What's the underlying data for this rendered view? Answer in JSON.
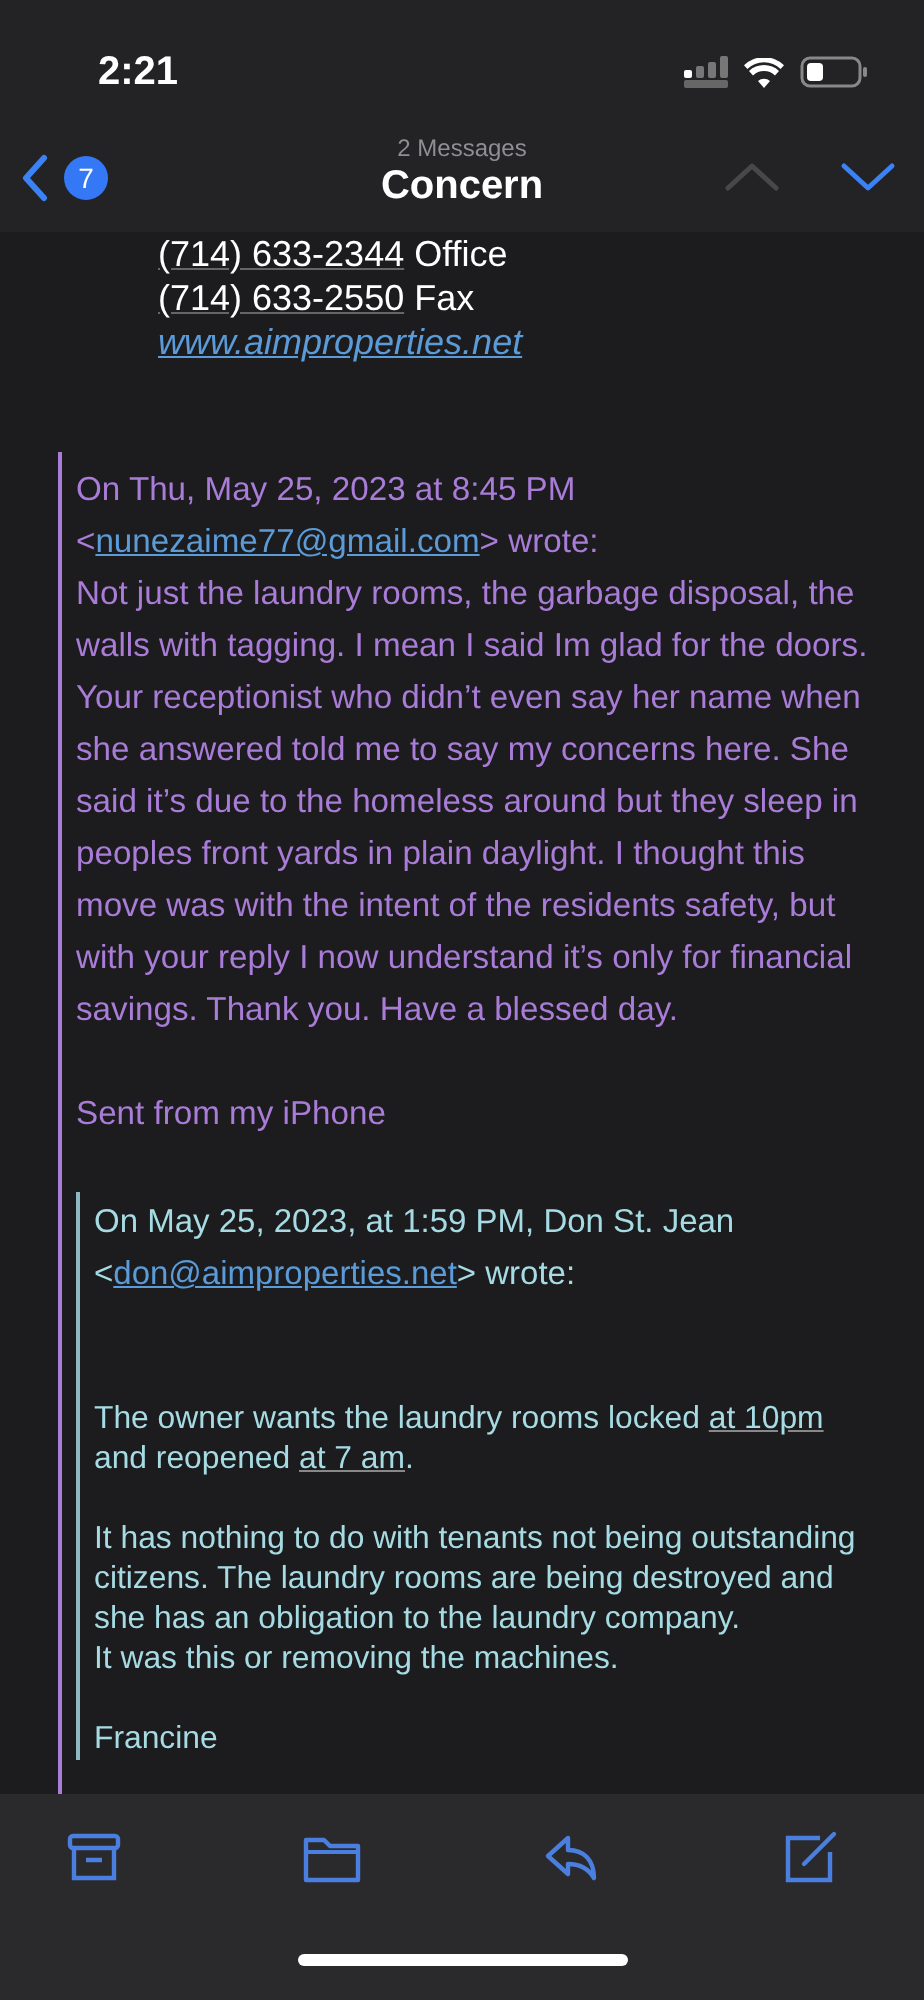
{
  "status_bar": {
    "time": "2:21"
  },
  "nav": {
    "back_badge": "7",
    "subtitle": "2 Messages",
    "title": "Concern",
    "arrows": [
      {
        "kind": "up",
        "disabled": true
      },
      {
        "kind": "down",
        "disabled": false
      }
    ]
  },
  "signature": [
    {
      "parts": [
        {
          "text": "(714) 633-2344",
          "kind": "phone"
        },
        {
          "text": " Office",
          "kind": "plain"
        }
      ]
    },
    {
      "parts": [
        {
          "text": "(714) 633-2550",
          "kind": "phone"
        },
        {
          "text": " Fax",
          "kind": "plain"
        }
      ]
    },
    {
      "parts": [
        {
          "text": "www.aimproperties.net",
          "kind": "link"
        }
      ]
    }
  ],
  "quotes": [
    {
      "color": "#a97cd8",
      "header": [
        {
          "text": "On Thu, May 25, 2023 at 8:45 PM <",
          "kind": "plain"
        },
        {
          "text": "nunezaime77@gmail.com",
          "kind": "link"
        },
        {
          "text": "> wrote:",
          "kind": "plain"
        }
      ],
      "paragraphs": [
        {
          "lines": [
            [
              {
                "text": "Not just the laundry rooms, the garbage disposal, the walls with tagging. I mean I said Im glad for the doors. Your receptionist who didn’t even say her name when she answered told me to say my concerns here. She said it’s due to the homeless around but they sleep in peoples front yards in plain daylight. I thought this move was with the intent of the residents safety, but with your reply I now understand it’s only for financial savings. Thank you. Have a blessed day.",
                "kind": "plain"
              }
            ]
          ]
        },
        {
          "lines": [
            [
              {
                "text": "Sent from my iPhone",
                "kind": "plain"
              }
            ]
          ]
        }
      ],
      "nested": {
        "color": "#a6dbe3",
        "header": [
          {
            "text": "On May 25, 2023, at 1:59 PM, Don St. Jean <",
            "kind": "plain"
          },
          {
            "text": "don@aimproperties.net",
            "kind": "link"
          },
          {
            "text": "> wrote:",
            "kind": "plain"
          }
        ],
        "paragraphs": [
          {
            "lines": [
              [
                {
                  "text": "The owner wants the laundry rooms locked ",
                  "kind": "plain"
                },
                {
                  "text": "at 10pm",
                  "kind": "detected"
                },
                {
                  "text": " and reopened ",
                  "kind": "plain"
                },
                {
                  "text": "at 7 am",
                  "kind": "detected"
                },
                {
                  "text": ".",
                  "kind": "plain"
                }
              ]
            ]
          },
          {
            "lines": [
              [
                {
                  "text": "It has nothing to do with tenants not being outstanding citizens. The laundry rooms are being destroyed and she has an obligation to the laundry company.",
                  "kind": "plain"
                }
              ],
              [
                {
                  "text": "It was this or removing the machines.",
                  "kind": "plain"
                }
              ]
            ]
          },
          {
            "lines": [
              [
                {
                  "text": "Francine",
                  "kind": "plain"
                }
              ]
            ]
          }
        ]
      }
    }
  ],
  "toolbar": [
    {
      "kind": "archive"
    },
    {
      "kind": "folder"
    },
    {
      "kind": "reply"
    },
    {
      "kind": "compose"
    }
  ]
}
